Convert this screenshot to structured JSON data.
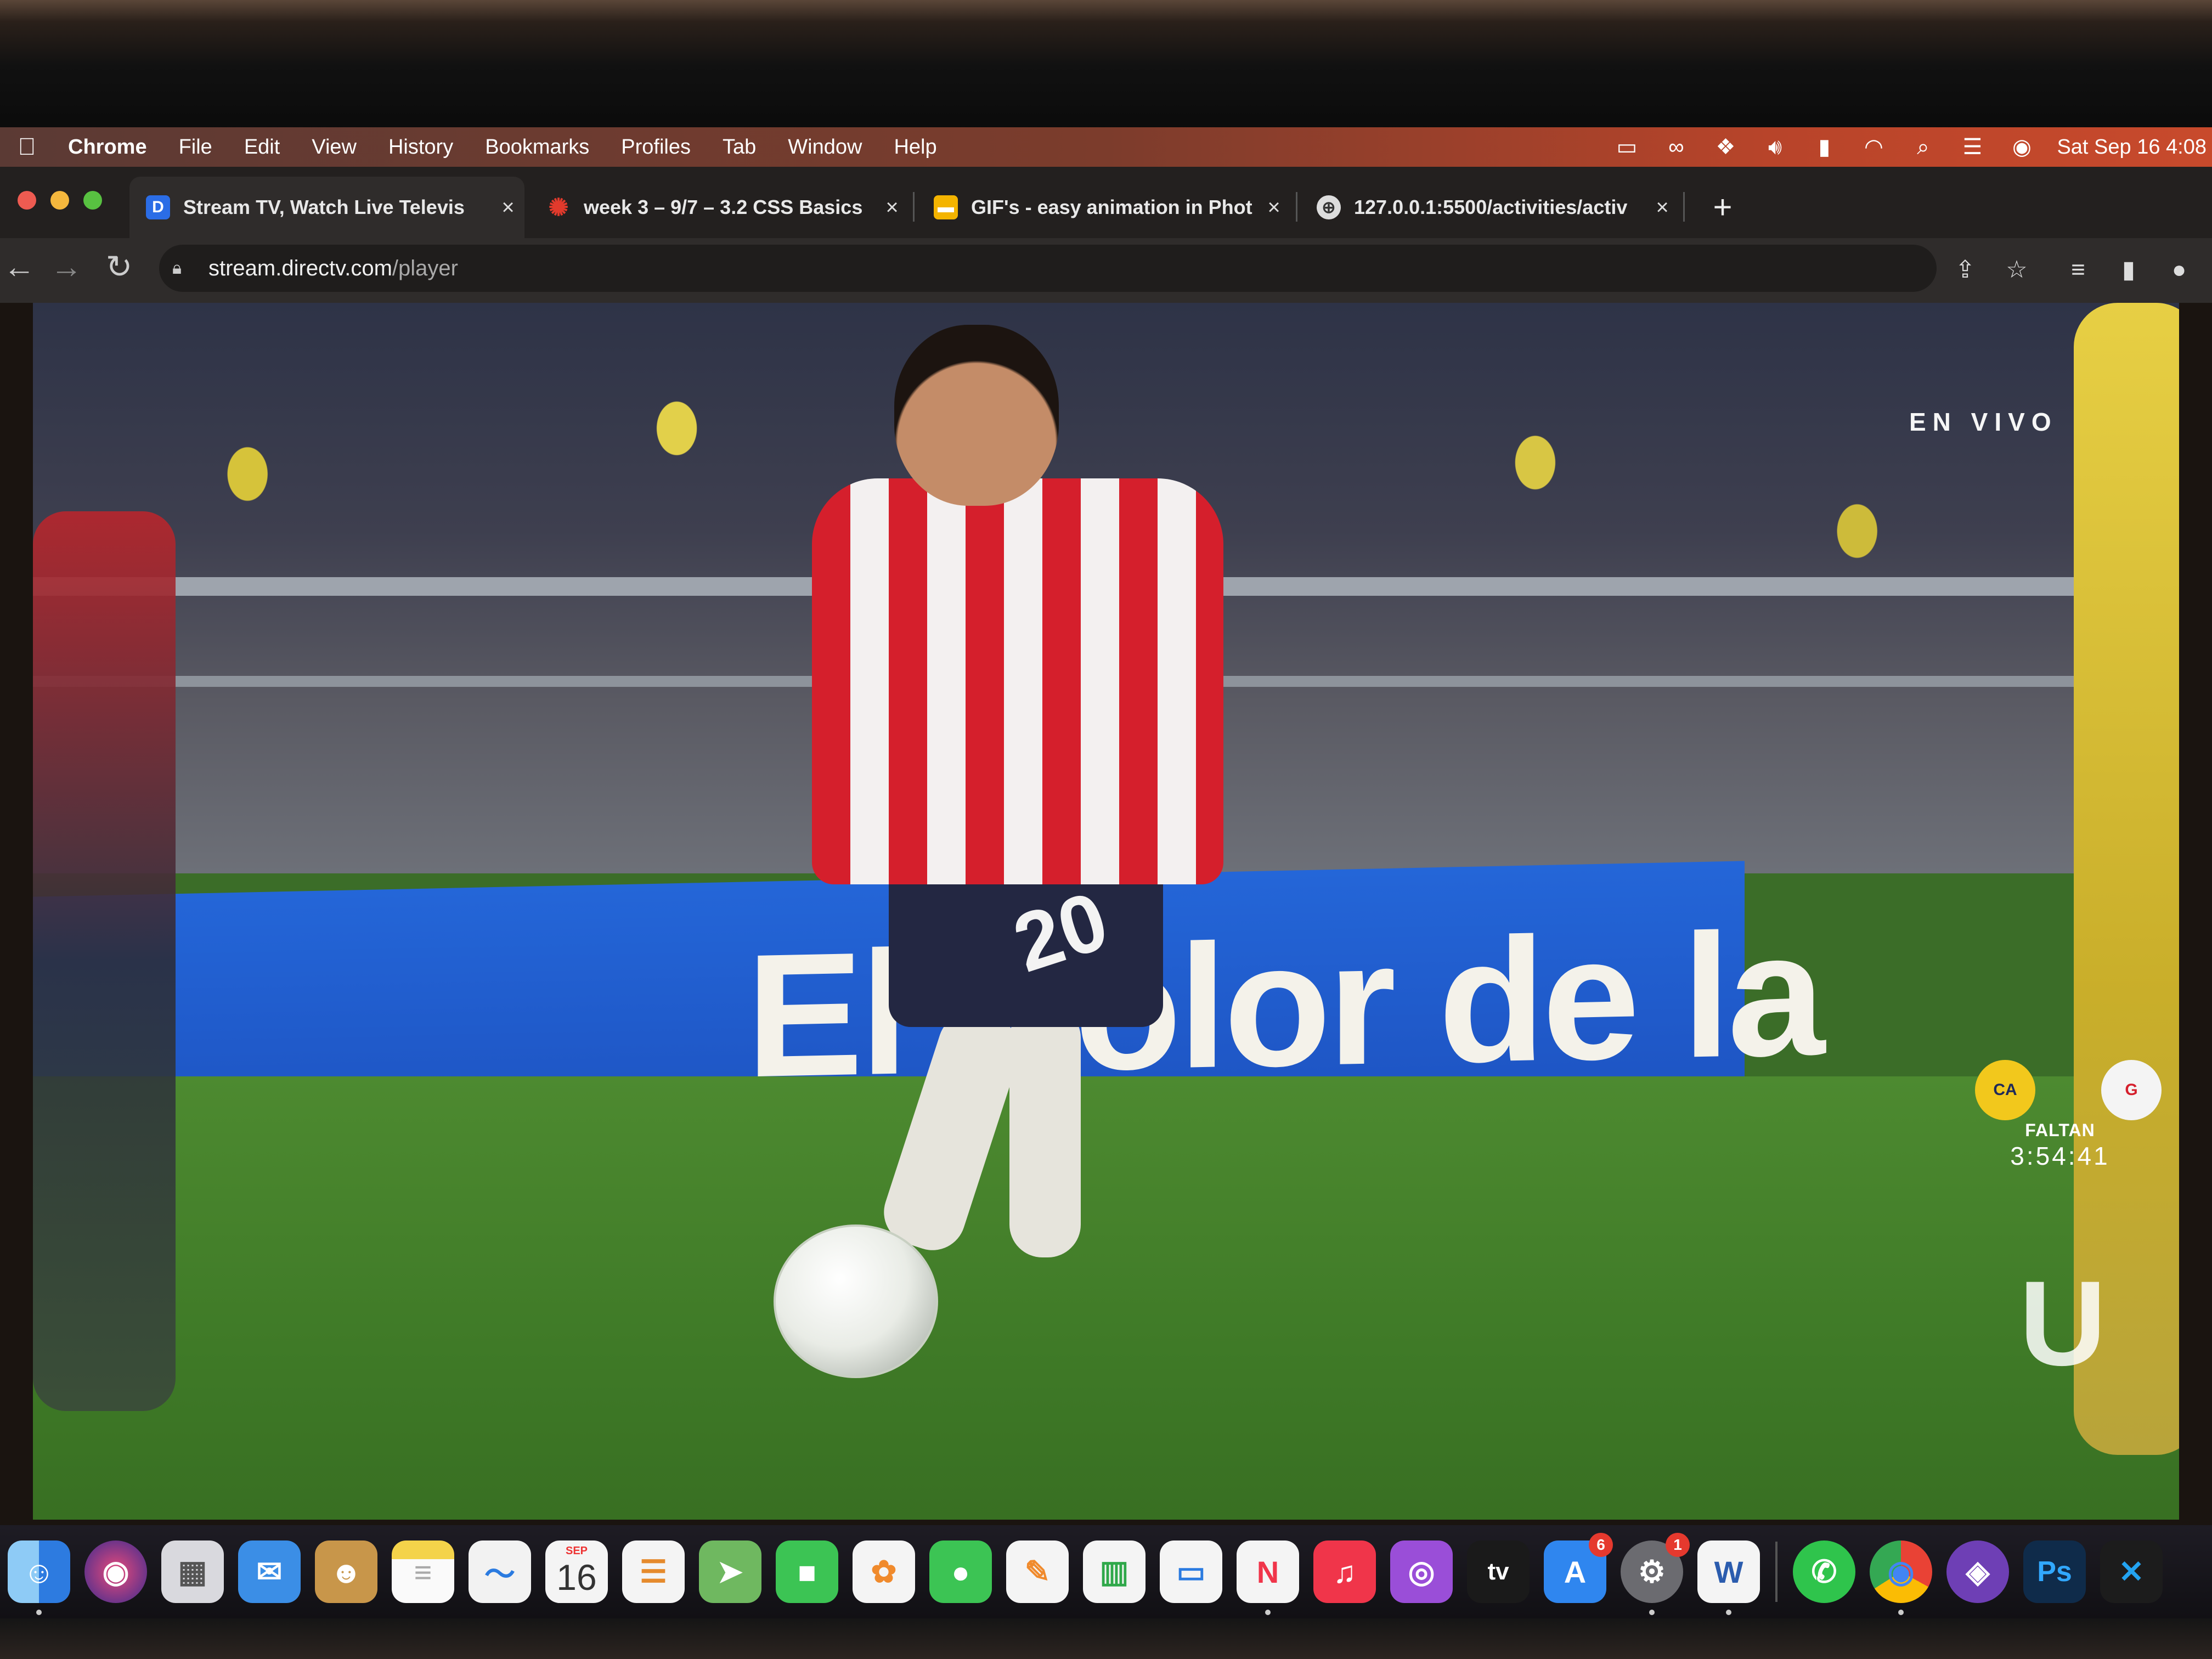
{
  "menubar": {
    "apple_icon": "apple-icon",
    "app_name": "Chrome",
    "items": [
      "File",
      "Edit",
      "View",
      "History",
      "Bookmarks",
      "Profiles",
      "Tab",
      "Window",
      "Help"
    ],
    "status_icons": [
      "screen-mirroring-icon",
      "creative-cloud-icon",
      "dropbox-icon",
      "volume-icon",
      "battery-icon",
      "wifi-icon",
      "spotlight-search-icon",
      "control-center-icon",
      "siri-icon"
    ],
    "clock": "Sat Sep 16  4:08"
  },
  "tabs": [
    {
      "title": "Stream TV, Watch Live Televis",
      "favicon_letter": "D",
      "favicon_color": "#2b6de6",
      "active": true
    },
    {
      "title": "week 3 – 9/7 – 3.2 CSS Basics",
      "favicon_letter": "✺",
      "favicon_color": "#e23a2c",
      "active": false
    },
    {
      "title": "GIF's - easy animation in Phot",
      "favicon_letter": "▬",
      "favicon_color": "#f4b400",
      "active": false
    },
    {
      "title": "127.0.0.1:5500/activities/activ",
      "favicon_letter": "⊕",
      "favicon_color": "#444444",
      "active": false
    }
  ],
  "new_tab_label": "+",
  "close_label": "×",
  "address_bar": {
    "host": "stream.directv.com",
    "path": "/player"
  },
  "nav": {
    "back": "←",
    "forward": "→",
    "reload": "↻"
  },
  "toolbar_icons": {
    "share": "⇪",
    "bookmark": "☆",
    "reading_list": "≡",
    "side_panel": "▮",
    "profile": "●"
  },
  "video": {
    "live_label": "EN VIVO",
    "board_text": "El Color de la",
    "jersey_number": "20",
    "team_home": {
      "name": "América",
      "color": "#f2c81c"
    },
    "team_away": {
      "name": "Chivas",
      "color": "#d51f2c"
    },
    "countdown_label": "FALTAN",
    "countdown": "3:54:41",
    "broadcaster_icon": "univision-logo"
  },
  "dock": {
    "apps": [
      {
        "name": "finder",
        "glyph": "☺",
        "color": "#3b8ee6"
      },
      {
        "name": "siri",
        "glyph": "◉",
        "color": "#5a2f7e"
      },
      {
        "name": "launchpad",
        "glyph": "▦",
        "color": "#d9d9de"
      },
      {
        "name": "mail",
        "glyph": "✉",
        "color": "#3b8ee6"
      },
      {
        "name": "contacts",
        "glyph": "☻",
        "color": "#c8964a"
      },
      {
        "name": "notes",
        "glyph": "≡",
        "color": "#f4d34a"
      },
      {
        "name": "freeform",
        "glyph": "〜",
        "color": "#f2f2f2"
      },
      {
        "name": "calendar",
        "glyph": "16",
        "color": "#f4f4f4",
        "month": "SEP"
      },
      {
        "name": "reminders",
        "glyph": "☰",
        "color": "#f4f4f4"
      },
      {
        "name": "maps",
        "glyph": "➤",
        "color": "#6fb860"
      },
      {
        "name": "facetime",
        "glyph": "■",
        "color": "#3cc454"
      },
      {
        "name": "photos",
        "glyph": "✿",
        "color": "#f4f4f4"
      },
      {
        "name": "messages",
        "glyph": "●",
        "color": "#3cc454"
      },
      {
        "name": "pages",
        "glyph": "✎",
        "color": "#f4f4f4"
      },
      {
        "name": "numbers",
        "glyph": "▥",
        "color": "#f4f4f4"
      },
      {
        "name": "keynote",
        "glyph": "▭",
        "color": "#f4f4f4"
      },
      {
        "name": "news",
        "glyph": "N",
        "color": "#f4f4f4"
      },
      {
        "name": "music",
        "glyph": "♫",
        "color": "#f0354a"
      },
      {
        "name": "podcasts",
        "glyph": "◎",
        "color": "#9a4ed8"
      },
      {
        "name": "apple-tv",
        "glyph": "tv",
        "color": "#1a1a1a"
      },
      {
        "name": "app-store",
        "glyph": "A",
        "color": "#2f86ef",
        "badge": "6"
      },
      {
        "name": "system-settings",
        "glyph": "⚙",
        "color": "#6b6b70",
        "badge": "1"
      },
      {
        "name": "word",
        "glyph": "W",
        "color": "#f4f4f4"
      }
    ],
    "pinned": [
      {
        "name": "whatsapp",
        "glyph": "✆",
        "color": "#2fc44c"
      },
      {
        "name": "chrome",
        "glyph": "◉",
        "color": "#f4f4f4"
      },
      {
        "name": "github-desktop",
        "glyph": "◈",
        "color": "#6e3fb5"
      },
      {
        "name": "photoshop",
        "glyph": "Ps",
        "color": "#0f2b4a"
      },
      {
        "name": "vscode",
        "glyph": "✕",
        "color": "#1c1c1c"
      }
    ]
  }
}
